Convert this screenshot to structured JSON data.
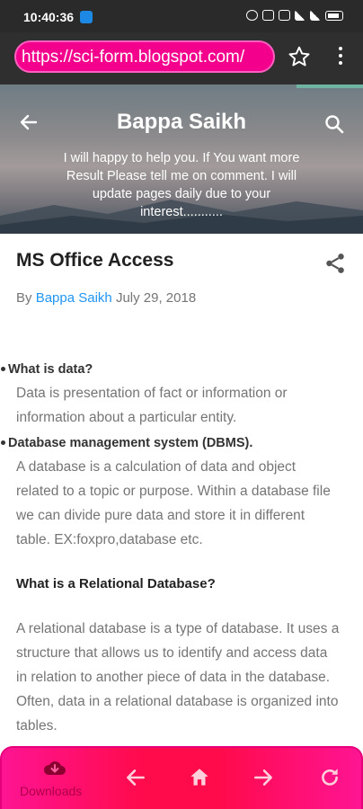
{
  "status_bar": {
    "time": "10:40:36"
  },
  "browser": {
    "url": "https://sci-form.blogspot.com/"
  },
  "blog": {
    "title": "Bappa Saikh",
    "description": "I will happy to help you. If You want more Result Please tell me on comment. I will update pages daily due to your interest..........."
  },
  "post": {
    "title": "MS Office Access",
    "by": "By",
    "author": "Bappa Saikh",
    "date": "July 29, 2018",
    "q1": "What is data?",
    "a1": "Data is presentation of fact or information or information about a particular entity.",
    "q2": "Database management system (DBMS).",
    "a2": "A database is a calculation of data and object related to a topic or purpose. Within a database file we can divide pure data and store it in different table. EX:foxpro,database etc.",
    "h3": "What is a Relational Database?",
    "a3": "A relational database is a type of database. It uses a structure that allows us to identify and access data in relation to another piece of data in the database. Often, data in a relational database is organized into tables."
  },
  "bottom_nav": {
    "downloads_label": "Downloads"
  },
  "colors": {
    "accent": "#f3008d",
    "nav": "#ff0a4a",
    "link": "#2196f3"
  }
}
